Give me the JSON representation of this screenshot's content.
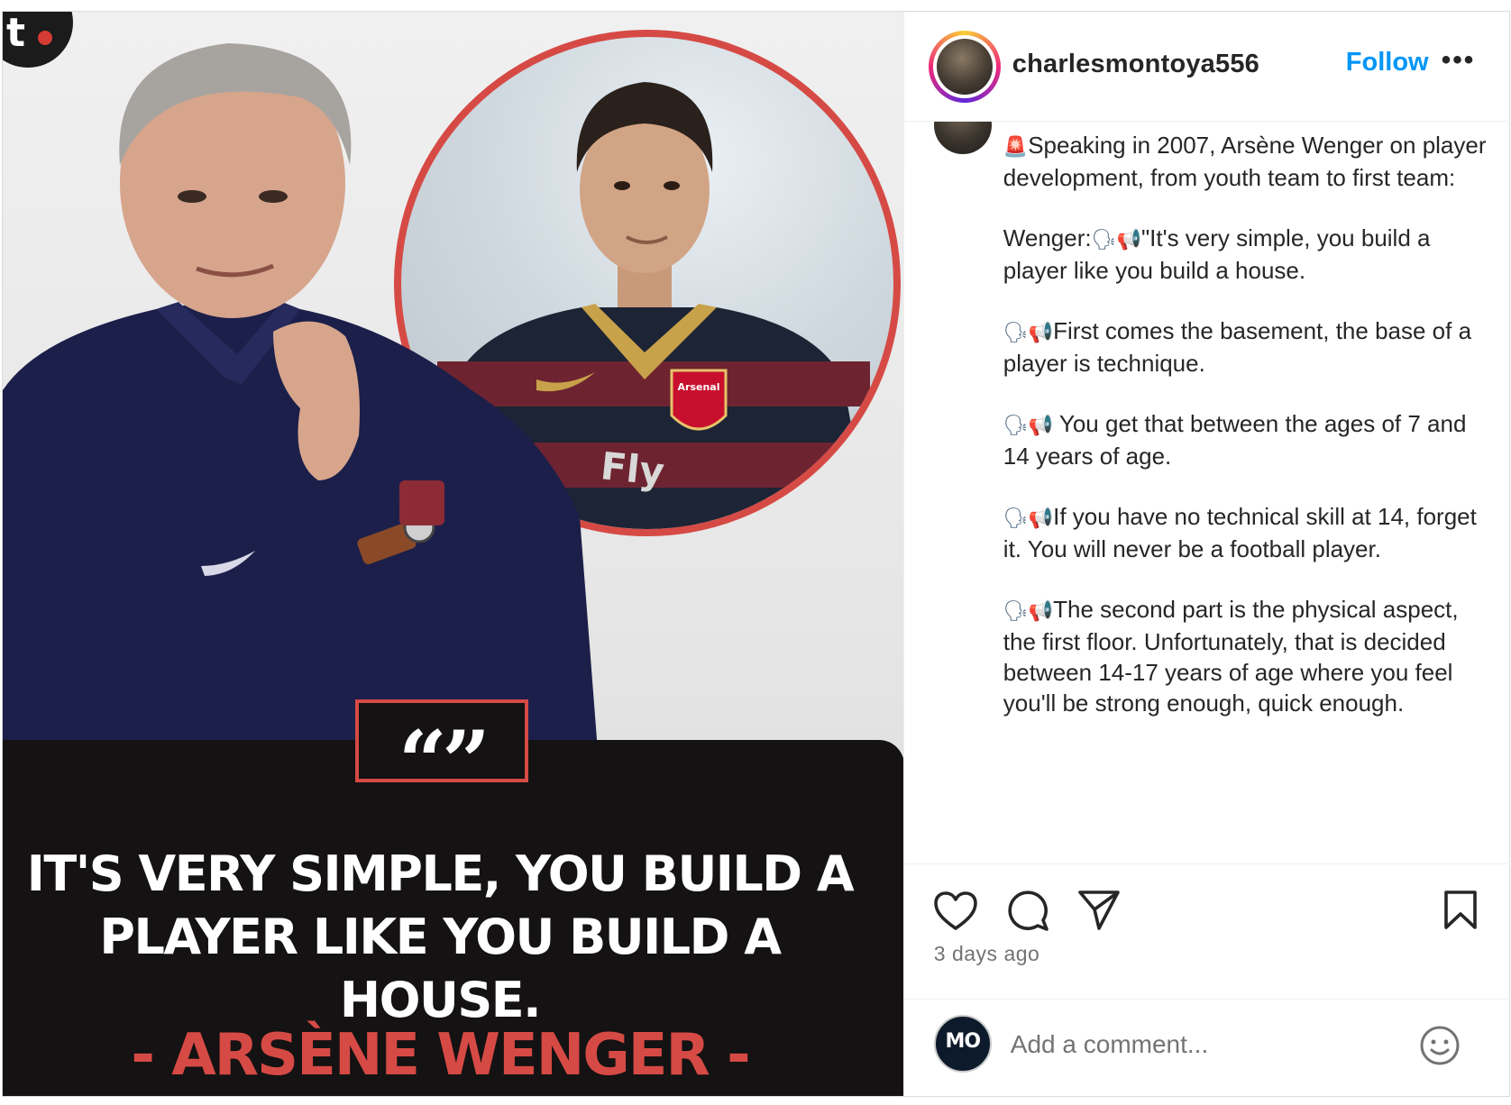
{
  "post": {
    "username": "charlesmontoya556",
    "follow_label": "Follow",
    "more_label": "•••",
    "timestamp": "3 days ago"
  },
  "media": {
    "quote_mark": "“”",
    "quote_text_line1": "IT'S VERY SIMPLE, YOU BUILD A",
    "quote_text_line2": "PLAYER LIKE YOU BUILD A HOUSE.",
    "quote_author": "- ARSÈNE WENGER -",
    "shirt_sponsor": "Fly",
    "club_crest": "Arsenal",
    "logo_letter": "t"
  },
  "caption": {
    "p1": "Speaking in 2007, Arsène Wenger on player development, from youth team to first team:",
    "p2_prefix": "Wenger:",
    "p2": "\"It's very simple, you build a player like you build a house.",
    "p3": "First comes the basement, the base of a player is technique.",
    "p4": " You get that between the ages of 7 and 14 years of age.",
    "p5": "If you have no technical skill at 14, forget it. You will never be a football player.",
    "p6": "The second part is the physical aspect, the first floor. Unfortunately, that is decided between 14-17 years of age where you feel you'll be strong enough, quick enough."
  },
  "icons": {
    "siren": "🚨",
    "speaking_head": "🗣",
    "megaphone": "📢"
  },
  "comment": {
    "placeholder": "Add a comment...",
    "avatar_text": "MO"
  },
  "colors": {
    "accent_red": "#d64a45",
    "follow_blue": "#0095f6",
    "panel_dark": "#141212",
    "muted_text": "#737373"
  }
}
